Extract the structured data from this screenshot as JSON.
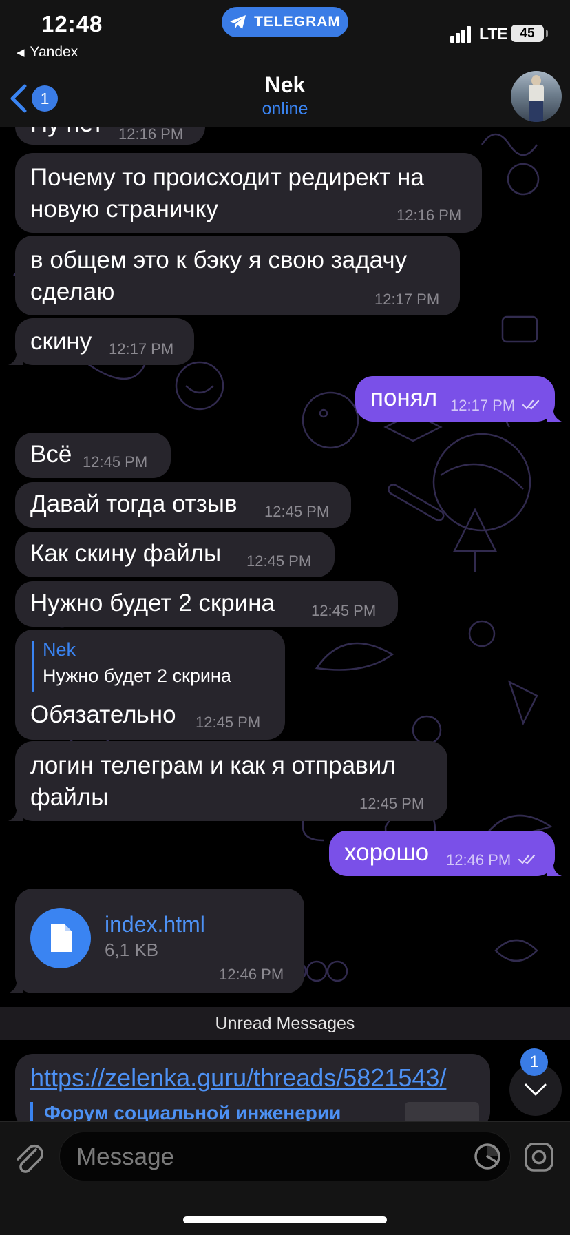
{
  "status_bar": {
    "time": "12:48",
    "back_app": "Yandex",
    "app_pill": "TELEGRAM",
    "network": "LTE",
    "battery": "45"
  },
  "header": {
    "back_badge": "1",
    "contact_name": "Nek",
    "contact_status": "online",
    "avatar_icon": "contact-avatar"
  },
  "messages": [
    {
      "dir": "in",
      "text": "Ну нет",
      "time": "12:16 PM"
    },
    {
      "dir": "in",
      "text_line1": "Почему то происходит редирект на",
      "text_line2": "новую страничку",
      "time": "12:16 PM"
    },
    {
      "dir": "in",
      "text_line1": "в общем это к бэку я свою задачу",
      "text_line2": "сделаю",
      "time": "12:17 PM"
    },
    {
      "dir": "in",
      "text": "скину",
      "time": "12:17 PM"
    },
    {
      "dir": "out",
      "text": "понял",
      "time": "12:17 PM",
      "read": true
    },
    {
      "dir": "in",
      "text": "Всё",
      "time": "12:45 PM"
    },
    {
      "dir": "in",
      "text": "Давай тогда отзыв",
      "time": "12:45 PM"
    },
    {
      "dir": "in",
      "text": "Как скину файлы",
      "time": "12:45 PM"
    },
    {
      "dir": "in",
      "text": "Нужно будет 2 скрина",
      "time": "12:45 PM"
    },
    {
      "dir": "in",
      "reply_name": "Nek",
      "reply_text": "Нужно будет 2 скрина",
      "text": "Обязательно",
      "time": "12:45 PM"
    },
    {
      "dir": "in",
      "text_line1": "логин телеграм и как я отправил",
      "text_line2": "файлы",
      "time": "12:45 PM"
    },
    {
      "dir": "out",
      "text": "хорошо",
      "time": "12:46 PM",
      "read": true
    },
    {
      "dir": "in",
      "file_name": "index.html",
      "file_size": "6,1 KB",
      "time": "12:46 PM",
      "icon": "document-icon"
    }
  ],
  "unread_divider": "Unread Messages",
  "link_message": {
    "url": "https://zelenka.guru/threads/5821543/",
    "preview_title": "Форум социальной инженерии"
  },
  "scroll_down": {
    "badge": "1"
  },
  "input": {
    "placeholder": "Message"
  },
  "colors": {
    "accent": "#3a84f2",
    "outgoing_bubble": "#7a50e8",
    "incoming_bubble": "#27252c",
    "background": "#000000"
  }
}
